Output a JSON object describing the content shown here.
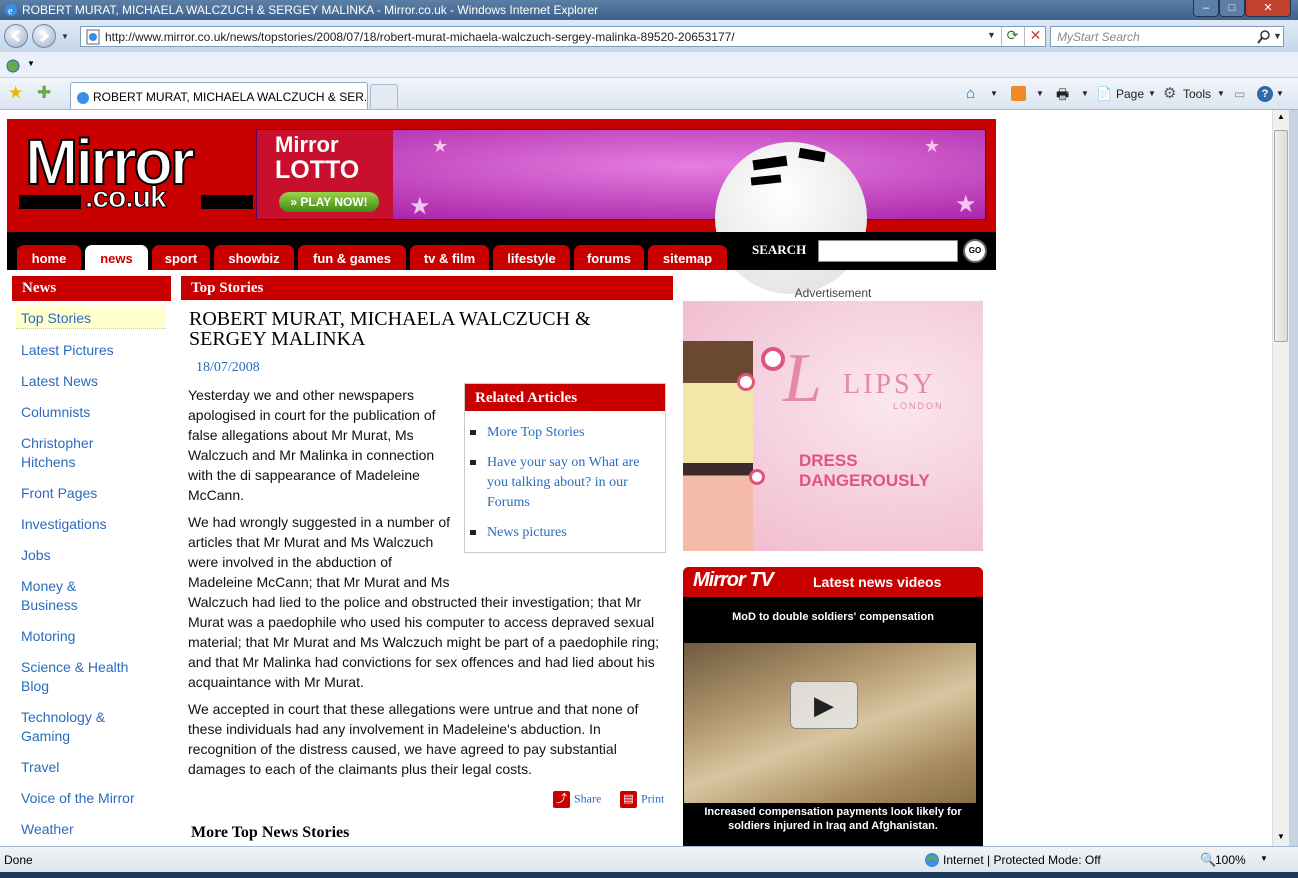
{
  "window": {
    "title": "ROBERT MURAT, MICHAELA WALCZUCH & SERGEY MALINKA - Mirror.co.uk - Windows Internet Explorer",
    "minimize": "–",
    "maximize": "□",
    "close": "✕"
  },
  "address": {
    "url": "http://www.mirror.co.uk/news/topstories/2008/07/18/robert-murat-michaela-walczuch-sergey-malinka-89520-20653177/",
    "search_placeholder": "MyStart Search"
  },
  "tabs": {
    "current": "ROBERT MURAT, MICHAELA WALCZUCH & SER..."
  },
  "toolbar": {
    "page": "Page",
    "tools": "Tools"
  },
  "site": {
    "logo_main": "Mirror",
    "logo_sub": ".co.uk",
    "banner": {
      "line1": "Mirror",
      "line2": "LOTTO",
      "play": "» PLAY NOW!"
    },
    "nav": [
      "home",
      "news",
      "sport",
      "showbiz",
      "fun & games",
      "tv & film",
      "lifestyle",
      "forums",
      "sitemap"
    ],
    "search_label": "SEARCH",
    "go": "GO"
  },
  "left_nav": {
    "heading": "News",
    "items": [
      "Top Stories",
      "Latest Pictures",
      "Latest News",
      "Columnists",
      "Christopher Hitchens",
      "Front Pages",
      "Investigations",
      "Jobs",
      "Money & Business",
      "Motoring",
      "Science & Health Blog",
      "Technology & Gaming",
      "Travel",
      "Voice of the Mirror",
      "Weather"
    ]
  },
  "article": {
    "section": "Top Stories",
    "headline": "ROBERT MURAT, MICHAELA WALCZUCH & SERGEY MALINKA",
    "date": "18/07/2008",
    "p1_lines": [
      "Yesterday we and other newspapers",
      "apologised in court for the publication of",
      "false allegations about Mr Murat, Ms",
      "Walczuch and Mr Malinka in connection",
      "with the di sappearance of Madeleine",
      "McCann."
    ],
    "p2_lines": [
      "We had wrongly suggested in a number of",
      "articles that Mr Murat and Ms Walczuch",
      "were involved in the abduction of",
      "Madeleine McCann; that Mr Murat and Ms",
      "Walczuch had lied to the police and obstructed their investigation; that Mr",
      "Murat was a paedophile who used his computer to access depraved sexual",
      "material; that Mr Murat and Ms Walczuch might be part of a paedophile ring;",
      "and that Mr Malinka had convictions for sex offences and had lied about his",
      "acquaintance with Mr Murat."
    ],
    "p3_lines": [
      "We accepted in court that these allegations were untrue and that none of",
      "these individuals had any involvement in Madeleine's abduction. In",
      "recognition of the distress caused, we have agreed to pay substantial",
      "damages to each of the claimants plus their legal costs."
    ],
    "share": "Share",
    "print": "Print",
    "more": "More Top News Stories"
  },
  "related": {
    "heading": "Related Articles",
    "items": [
      "More Top Stories",
      "Have your say on What are you talking about? in our Forums",
      "News pictures"
    ]
  },
  "ads": {
    "label": "Advertisement",
    "lipsy_brand": "LIPSY",
    "lipsy_sub": "LONDON",
    "lipsy_tag": "DRESS DANGEROUSLY",
    "lipsy_l": "L"
  },
  "mirror_tv": {
    "logo": "Mirror TV",
    "heading": "Latest news videos",
    "caption": "MoD to double soldiers' compensation",
    "footer": "Increased compensation payments look likely for soldiers injured in Iraq and Afghanistan."
  },
  "status": {
    "left": "Done",
    "zone": "Internet | Protected Mode: Off",
    "zoom": "100%"
  },
  "colors": {
    "mirror_red": "#c90000",
    "link_blue": "#2a6bbd"
  }
}
